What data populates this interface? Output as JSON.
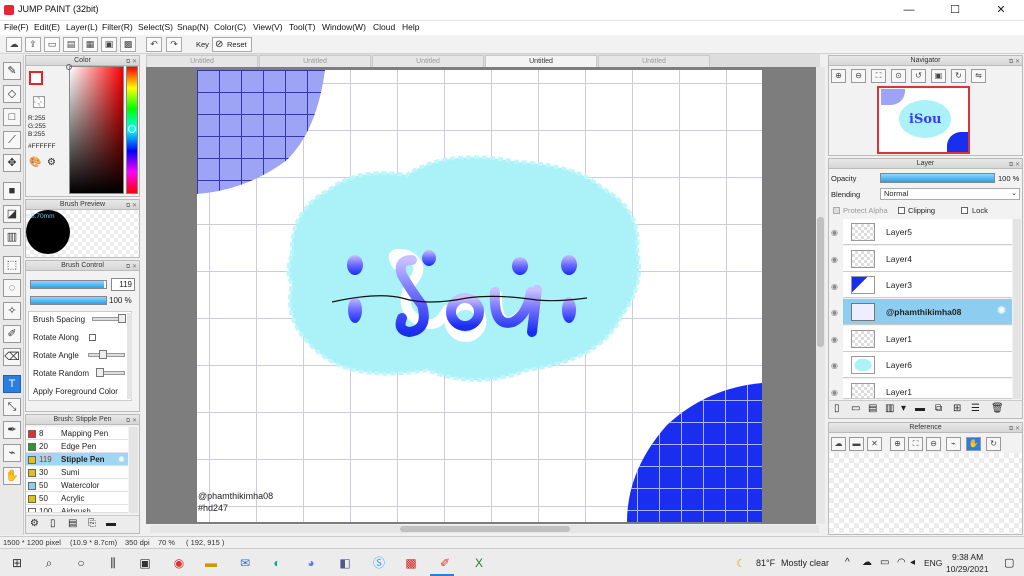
{
  "window": {
    "title": "JUMP PAINT (32bit)",
    "min": "—",
    "max": "☐",
    "close": "✕"
  },
  "menu": [
    "File(F)",
    "Edit(E)",
    "Layer(L)",
    "Filter(R)",
    "Select(S)",
    "Snap(N)",
    "Color(C)",
    "View(V)",
    "Tool(T)",
    "Window(W)",
    "Cloud",
    "Help"
  ],
  "toolbar": {
    "key_label": "Key",
    "reset_label": "Reset"
  },
  "tabs": [
    "Untitled",
    "Untitled",
    "Untitled",
    "Untitled",
    "Untitled"
  ],
  "color_panel": {
    "title": "Color",
    "r": "R:255",
    "g": "G:255",
    "b": "B:255",
    "hex": "#FFFFFF"
  },
  "brush_preview": {
    "title": "Brush Preview",
    "size": "8.70mm"
  },
  "brush_control": {
    "title": "Brush Control",
    "size_value": "119",
    "opacity_value": "100 %",
    "size_fill": 0.97,
    "opacity_fill": 1.0,
    "options": [
      "Brush Spacing",
      "Rotate Along",
      "Rotate Angle",
      "Rotate Random",
      "Apply Foreground Color"
    ]
  },
  "brush_list": {
    "title": "Brush: Stipple Pen",
    "items": [
      {
        "size": "8",
        "name": "Mapping Pen",
        "color": "#e03030"
      },
      {
        "size": "20",
        "name": "Edge Pen",
        "color": "#2a9a2a"
      },
      {
        "size": "119",
        "name": "Stipple Pen",
        "color": "#e0c020"
      },
      {
        "size": "30",
        "name": "Sumi",
        "color": "#e0c020"
      },
      {
        "size": "50",
        "name": "Watercolor",
        "color": "#8ad0f0"
      },
      {
        "size": "50",
        "name": "Acrylic",
        "color": "#e0c020"
      },
      {
        "size": "100",
        "name": "Airbrush",
        "color": "#ffffff"
      }
    ]
  },
  "canvas": {
    "word": "iSou",
    "watermark": "@phamthikimha08",
    "tag": "#hd247"
  },
  "navigator": {
    "title": "Navigator"
  },
  "layer_panel": {
    "title": "Layer",
    "opacity_label": "Opacity",
    "opacity_value": "100 %",
    "blending_label": "Blending",
    "blending_value": "Normal",
    "protect_alpha": "Protect Alpha",
    "clipping": "Clipping",
    "lock": "Lock",
    "layers": [
      {
        "name": "Layer5"
      },
      {
        "name": "Layer4"
      },
      {
        "name": "Layer3"
      },
      {
        "name": "@phamthikimha08",
        "selected": true
      },
      {
        "name": "Layer1"
      },
      {
        "name": "Layer6"
      },
      {
        "name": "Layer1"
      }
    ]
  },
  "reference": {
    "title": "Reference"
  },
  "status": {
    "dims": "1500 * 1200 pixel",
    "size": "(10.9 * 8.7cm)",
    "dpi": "350 dpi",
    "zoom": "70 %",
    "coords": "( 192, 915 )"
  },
  "taskbar": {
    "weather_temp": "81°F",
    "weather_text": "Mostly clear",
    "lang": "ENG",
    "time": "9:38 AM",
    "date": "10/29/2021"
  },
  "colors": {
    "accent": "#2a7de1",
    "selection": "#8ccdf0",
    "cloud": "#aaf2f8",
    "deep_blue": "#1a2ef0"
  }
}
